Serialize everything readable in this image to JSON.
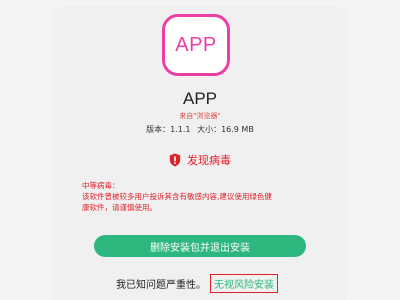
{
  "app": {
    "icon_text": "APP",
    "name": "APP",
    "source": "来自\"浏览器\"",
    "version_label": "版本：1.1.1",
    "size_label": "大小：16.9 MB"
  },
  "warning": {
    "title": "发现病毒",
    "severity": "中等病毒：",
    "lines": [
      "该软件曾被较多用户投诉其含有敏感内容,建议使用绿色健",
      "康软件，请谨慎使用。"
    ]
  },
  "actions": {
    "primary_label": "删除安装包并退出安装",
    "confirm_text": "我已知问题严重性。",
    "risk_install_label": "无视风险安装"
  },
  "colors": {
    "accent_pink": "#ec3ea4",
    "warning_red": "#e0202a",
    "action_green": "#2db77f"
  }
}
